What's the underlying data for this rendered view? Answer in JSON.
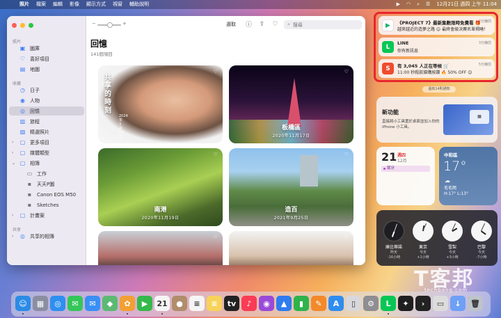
{
  "menubar": {
    "app": "照片",
    "items": [
      "檔案",
      "編輯",
      "影像",
      "顯示方式",
      "視窗",
      "輔助說明"
    ],
    "clock": "12月21日 週四 上午 11:04"
  },
  "sidebar": {
    "section_photos": "照片",
    "library": "圖庫",
    "favorites": "喜好項目",
    "map": "地圖",
    "section_collections": "收藏",
    "days": "日子",
    "people": "人物",
    "memories": "回憶",
    "trips": "旅程",
    "featured": "精選照片",
    "more_items": "更多項目",
    "media_types": "媒體類型",
    "albums": "相簿",
    "album_work": "工作",
    "album_day": "天天P圖",
    "album_canon": "Canon EOS M50",
    "album_sketches": "Sketches",
    "projects": "計畫案",
    "section_shared": "共享",
    "shared_albums": "共享的相簿"
  },
  "toolbar": {
    "select": "選取",
    "search_placeholder": "搜尋"
  },
  "main": {
    "title": "回憶",
    "count": "141個項目",
    "cards": [
      {
        "title": "共享的時刻",
        "date": "2024年3月17日"
      },
      {
        "title": "板橋區",
        "date": "2020年11月17日"
      },
      {
        "title": "南港",
        "date": "2020年11月19日"
      },
      {
        "title": "造百",
        "date": "2021年9月25日"
      }
    ]
  },
  "notifications": [
    {
      "app": "PROJECT 7",
      "title": "《PROJECT 7》最新集數限時免費看 🎁",
      "body": "越來越近的造夢之路 😊 最終會級決賽名單揭曉！",
      "time": "2分鐘前"
    },
    {
      "app": "LINE",
      "title": "LINE",
      "body": "你有新訊息",
      "time": "3分鐘前"
    },
    {
      "app": "蝦皮",
      "title": "有 3,045 人正在等候 🛒",
      "body": "11:00 秒殺款搶購按讚 🔥 50% OFF 😊",
      "time": "5分鐘前"
    }
  ],
  "more_notifications": "還有14則通知",
  "widgets": {
    "new_feature": {
      "title": "新功能",
      "desc": "直接將小工具置於桌面並加入你的 iPhone 小工具。"
    },
    "calendar": {
      "day": "21",
      "weekday": "週四",
      "month": "12月",
      "event": "尾牙"
    },
    "weather": {
      "city": "中和區",
      "temp": "17°",
      "icon": "cloud-icon",
      "condition": "毛毛雨",
      "hilo": "H:17° L:13°"
    },
    "clocks": [
      {
        "city": "庫比蒂諾",
        "day": "昨天",
        "offset": "-16小時"
      },
      {
        "city": "東京",
        "day": "今天",
        "offset": "+1小時"
      },
      {
        "city": "雪梨",
        "day": "今天",
        "offset": "+3小時"
      },
      {
        "city": "巴黎",
        "day": "今天",
        "offset": "-7小時"
      }
    ]
  },
  "watermark": {
    "text": "T客邦",
    "url": "techbang.com"
  },
  "dock": [
    {
      "name": "finder-icon",
      "color": "#2b8be6",
      "glyph": "☺"
    },
    {
      "name": "launchpad-icon",
      "color": "#8a8ea0",
      "glyph": "▦"
    },
    {
      "name": "safari-icon",
      "color": "#2e8ff0",
      "glyph": "◎"
    },
    {
      "name": "messages-icon",
      "color": "#34c759",
      "glyph": "✉"
    },
    {
      "name": "mail-icon",
      "color": "#3a8ff5",
      "glyph": "✉"
    },
    {
      "name": "maps-icon",
      "color": "#5bb974",
      "glyph": "◆"
    },
    {
      "name": "photos-icon",
      "color": "#f2a033",
      "glyph": "✿"
    },
    {
      "name": "facetime-icon",
      "color": "#35b94b",
      "glyph": "▶"
    },
    {
      "name": "calendar-icon",
      "color": "#f5f5f5",
      "glyph": "21"
    },
    {
      "name": "contacts-icon",
      "color": "#b08d6b",
      "glyph": "●"
    },
    {
      "name": "reminders-icon",
      "color": "#f5f5f5",
      "glyph": "≡"
    },
    {
      "name": "notes-icon",
      "color": "#f7d35a",
      "glyph": "≡"
    },
    {
      "name": "tv-icon",
      "color": "#222222",
      "glyph": "tv"
    },
    {
      "name": "music-icon",
      "color": "#fa3c56",
      "glyph": "♪"
    },
    {
      "name": "podcasts-icon",
      "color": "#9b49d8",
      "glyph": "◉"
    },
    {
      "name": "keynote-icon",
      "color": "#2f7bf0",
      "glyph": "▲"
    },
    {
      "name": "numbers-icon",
      "color": "#2fb34c",
      "glyph": "▮"
    },
    {
      "name": "pages-icon",
      "color": "#f28a2b",
      "glyph": "✎"
    },
    {
      "name": "app-store-icon",
      "color": "#2f8df0",
      "glyph": "A"
    },
    {
      "name": "iphone-mirroring-icon",
      "color": "#d8d8dc",
      "glyph": "▯"
    },
    {
      "name": "system-settings-icon",
      "color": "#8e8e93",
      "glyph": "⚙"
    },
    {
      "name": "line-icon",
      "color": "#06c755",
      "glyph": "L"
    },
    {
      "name": "chatgpt-icon",
      "color": "#1f1f1f",
      "glyph": "✦"
    },
    {
      "name": "terminal-icon",
      "color": "#222222",
      "glyph": "›"
    },
    {
      "name": "preview-icon",
      "color": "#dcdcdc",
      "glyph": "▭"
    },
    {
      "name": "downloads-icon",
      "color": "#6ea0f5",
      "glyph": "↓"
    },
    {
      "name": "trash-icon",
      "color": "#bfc3ca",
      "glyph": "🗑"
    }
  ]
}
